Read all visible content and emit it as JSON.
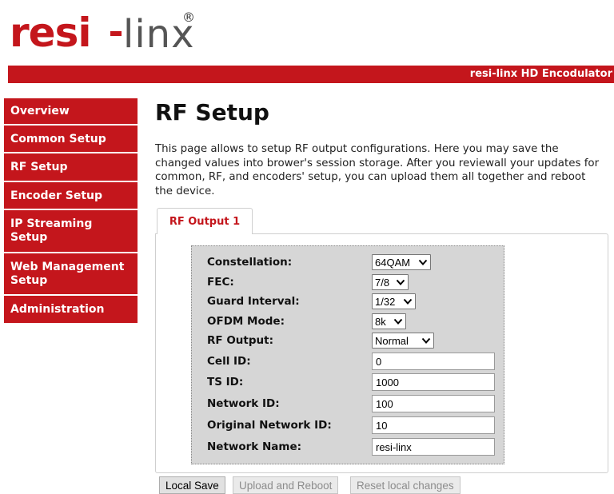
{
  "logo": {
    "part1": "resi",
    "part2": "linx",
    "reg": "®"
  },
  "header": {
    "product": "resi-linx HD Encodulator"
  },
  "nav": {
    "items": [
      {
        "label": "Overview"
      },
      {
        "label": "Common Setup"
      },
      {
        "label": "RF Setup"
      },
      {
        "label": "Encoder Setup"
      },
      {
        "label": "IP Streaming Setup"
      },
      {
        "label": "Web Management Setup"
      },
      {
        "label": "Administration"
      }
    ]
  },
  "page": {
    "title": "RF Setup",
    "description": "This page allows to setup RF output configurations. Here you may save the changed values into brower's session storage. After you reviewall your updates for common, RF, and encoders' setup, you can upload them all together and reboot the device."
  },
  "tabs": [
    {
      "label": "RF Output 1"
    }
  ],
  "form": {
    "constellation": {
      "label": "Constellation:",
      "value": "64QAM"
    },
    "fec": {
      "label": "FEC:",
      "value": "7/8"
    },
    "guard_interval": {
      "label": "Guard Interval:",
      "value": "1/32"
    },
    "ofdm_mode": {
      "label": "OFDM Mode:",
      "value": "8k"
    },
    "rf_output": {
      "label": "RF Output:",
      "value": "Normal"
    },
    "cell_id": {
      "label": "Cell ID:",
      "value": "0"
    },
    "ts_id": {
      "label": "TS ID:",
      "value": "1000"
    },
    "network_id": {
      "label": "Network ID:",
      "value": "100"
    },
    "original_network_id": {
      "label": "Original Network ID:",
      "value": "10"
    },
    "network_name": {
      "label": "Network Name:",
      "value": "resi-linx"
    }
  },
  "buttons": {
    "local_save": "Local Save",
    "upload_reboot": "Upload and Reboot",
    "reset": "Reset local changes"
  },
  "colors": {
    "brand_red": "#c4161c",
    "form_bg": "#d6d6d6"
  }
}
